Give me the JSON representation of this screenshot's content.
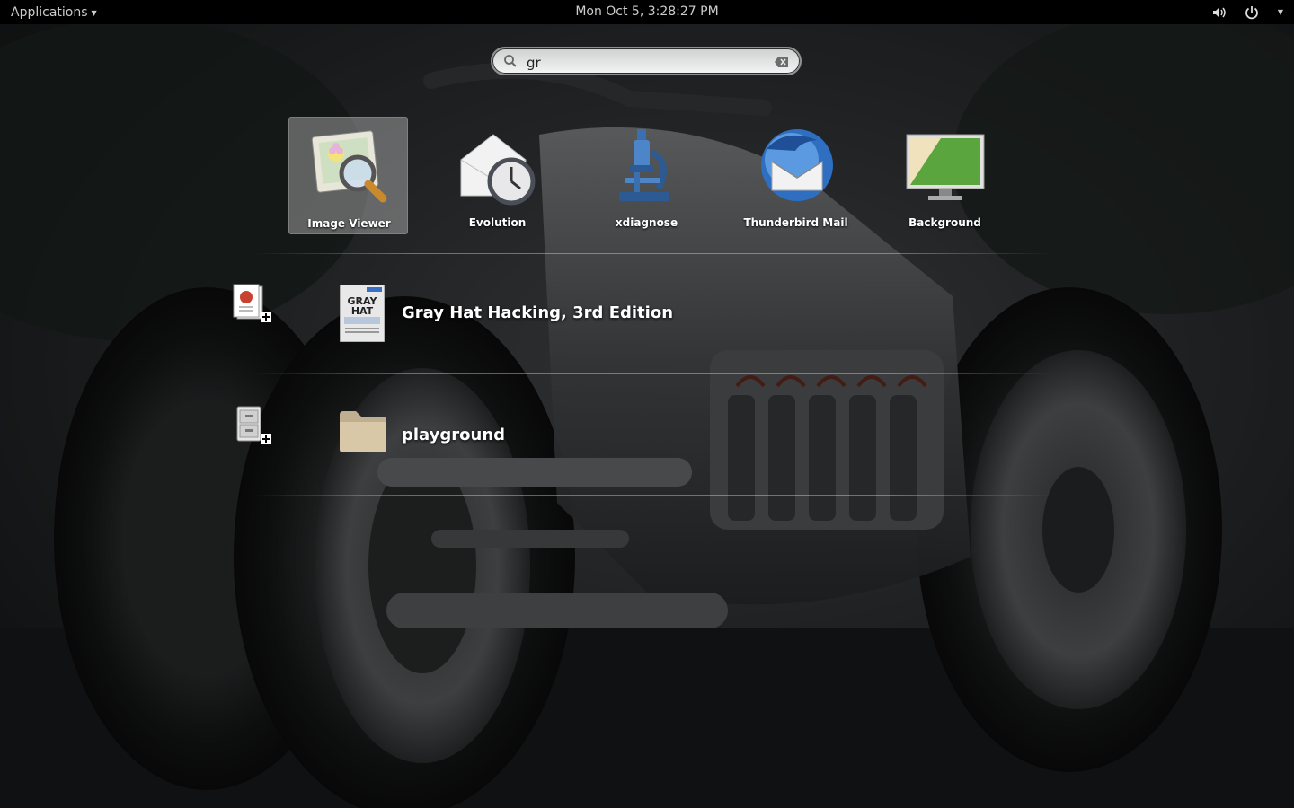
{
  "topbar": {
    "applications_label": "Applications",
    "clock": "Mon Oct  5,  3:28:27 PM"
  },
  "search": {
    "value": "gr"
  },
  "apps": [
    {
      "label": "Image Viewer",
      "icon": "image-viewer-icon",
      "selected": true
    },
    {
      "label": "Evolution",
      "icon": "evolution-icon",
      "selected": false
    },
    {
      "label": "xdiagnose",
      "icon": "microscope-icon",
      "selected": false
    },
    {
      "label": "Thunderbird Mail",
      "icon": "thunderbird-icon",
      "selected": false
    },
    {
      "label": "Background",
      "icon": "background-icon",
      "selected": false
    }
  ],
  "results": {
    "documents": {
      "provider_icon": "document-viewer-provider-icon",
      "item_label": "Gray Hat Hacking, 3rd Edition",
      "item_icon": "book-cover-thumbnail"
    },
    "files": {
      "provider_icon": "file-cabinet-provider-icon",
      "item_label": "playground",
      "item_icon": "folder-icon"
    }
  },
  "colors": {
    "topbar": "#000000",
    "selected_tile": "#a8a8a8",
    "folder": "#d8c8a8"
  }
}
